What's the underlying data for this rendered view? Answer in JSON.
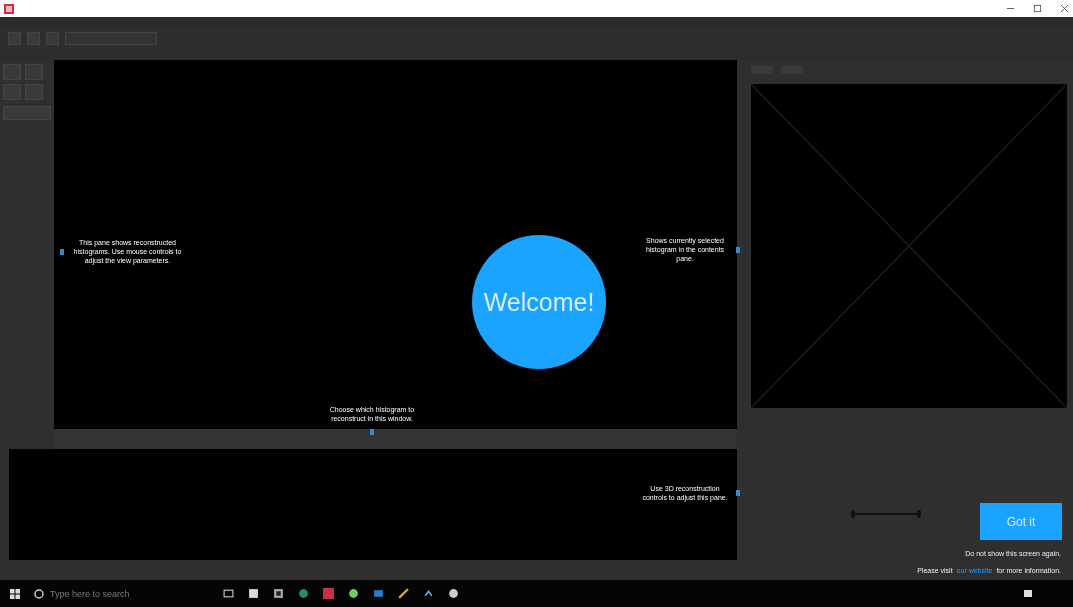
{
  "welcome": {
    "title": "Welcome!"
  },
  "hints": [
    {
      "text": "This pane shows reconstructed histograms. Use mouse controls to adjust the view parameters.",
      "kind": "left"
    },
    {
      "text": "Shows currently selected histogram in the contents pane.",
      "kind": "right"
    },
    {
      "text": "Choose which histogram to reconstruct in this window.",
      "kind": "down"
    },
    {
      "text": "Use 3D reconstruction controls to adjust this pane.",
      "kind": "right"
    }
  ],
  "range_slider": {
    "level": 1
  },
  "got_it_button": "Got it",
  "dont_show_note": "Do not show this screen again.",
  "visit_note": {
    "before": "Please visit",
    "link": "our website",
    "after": "for more information."
  },
  "taskbar": {
    "search": {
      "placeholder": "Type here to search"
    }
  }
}
